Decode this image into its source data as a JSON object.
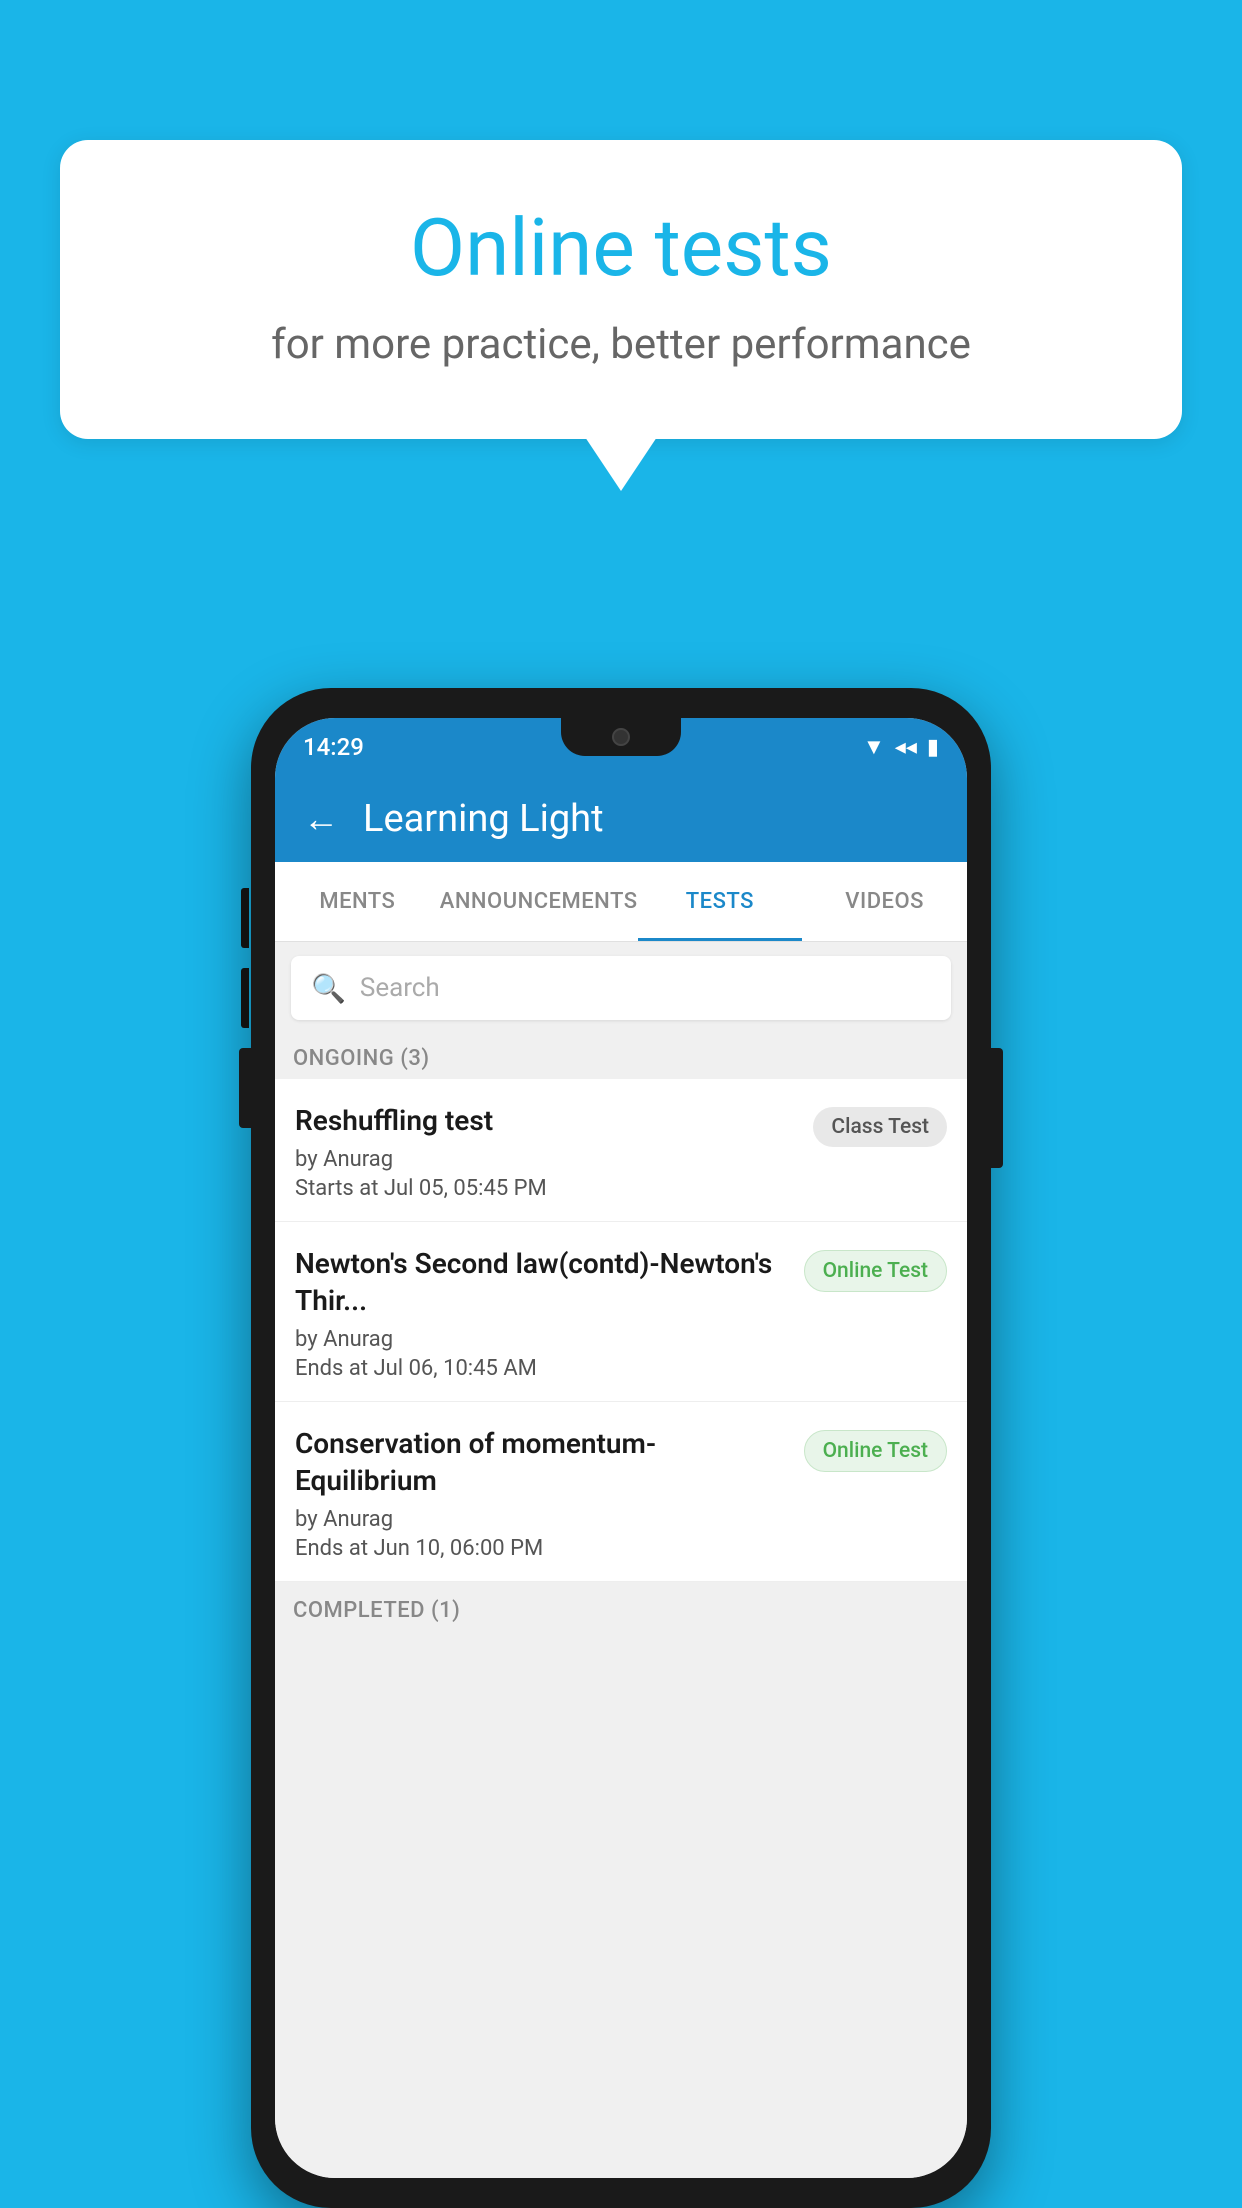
{
  "background_color": "#1ab5e8",
  "bubble": {
    "title": "Online tests",
    "subtitle": "for more practice, better performance"
  },
  "phone": {
    "status_bar": {
      "time": "14:29",
      "icons": [
        "wifi",
        "signal",
        "battery"
      ]
    },
    "app_bar": {
      "title": "Learning Light",
      "back_label": "←"
    },
    "tabs": [
      {
        "label": "MENTS",
        "active": false
      },
      {
        "label": "ANNOUNCEMENTS",
        "active": false
      },
      {
        "label": "TESTS",
        "active": true
      },
      {
        "label": "VIDEOS",
        "active": false
      }
    ],
    "search": {
      "placeholder": "Search"
    },
    "ongoing_section": {
      "label": "ONGOING (3)"
    },
    "test_items": [
      {
        "name": "Reshuffling test",
        "by": "by Anurag",
        "time": "Starts at  Jul 05, 05:45 PM",
        "badge": "Class Test",
        "badge_type": "class"
      },
      {
        "name": "Newton's Second law(contd)-Newton's Thir...",
        "by": "by Anurag",
        "time": "Ends at  Jul 06, 10:45 AM",
        "badge": "Online Test",
        "badge_type": "online"
      },
      {
        "name": "Conservation of momentum-Equilibrium",
        "by": "by Anurag",
        "time": "Ends at  Jun 10, 06:00 PM",
        "badge": "Online Test",
        "badge_type": "online"
      }
    ],
    "completed_section": {
      "label": "COMPLETED (1)"
    }
  }
}
